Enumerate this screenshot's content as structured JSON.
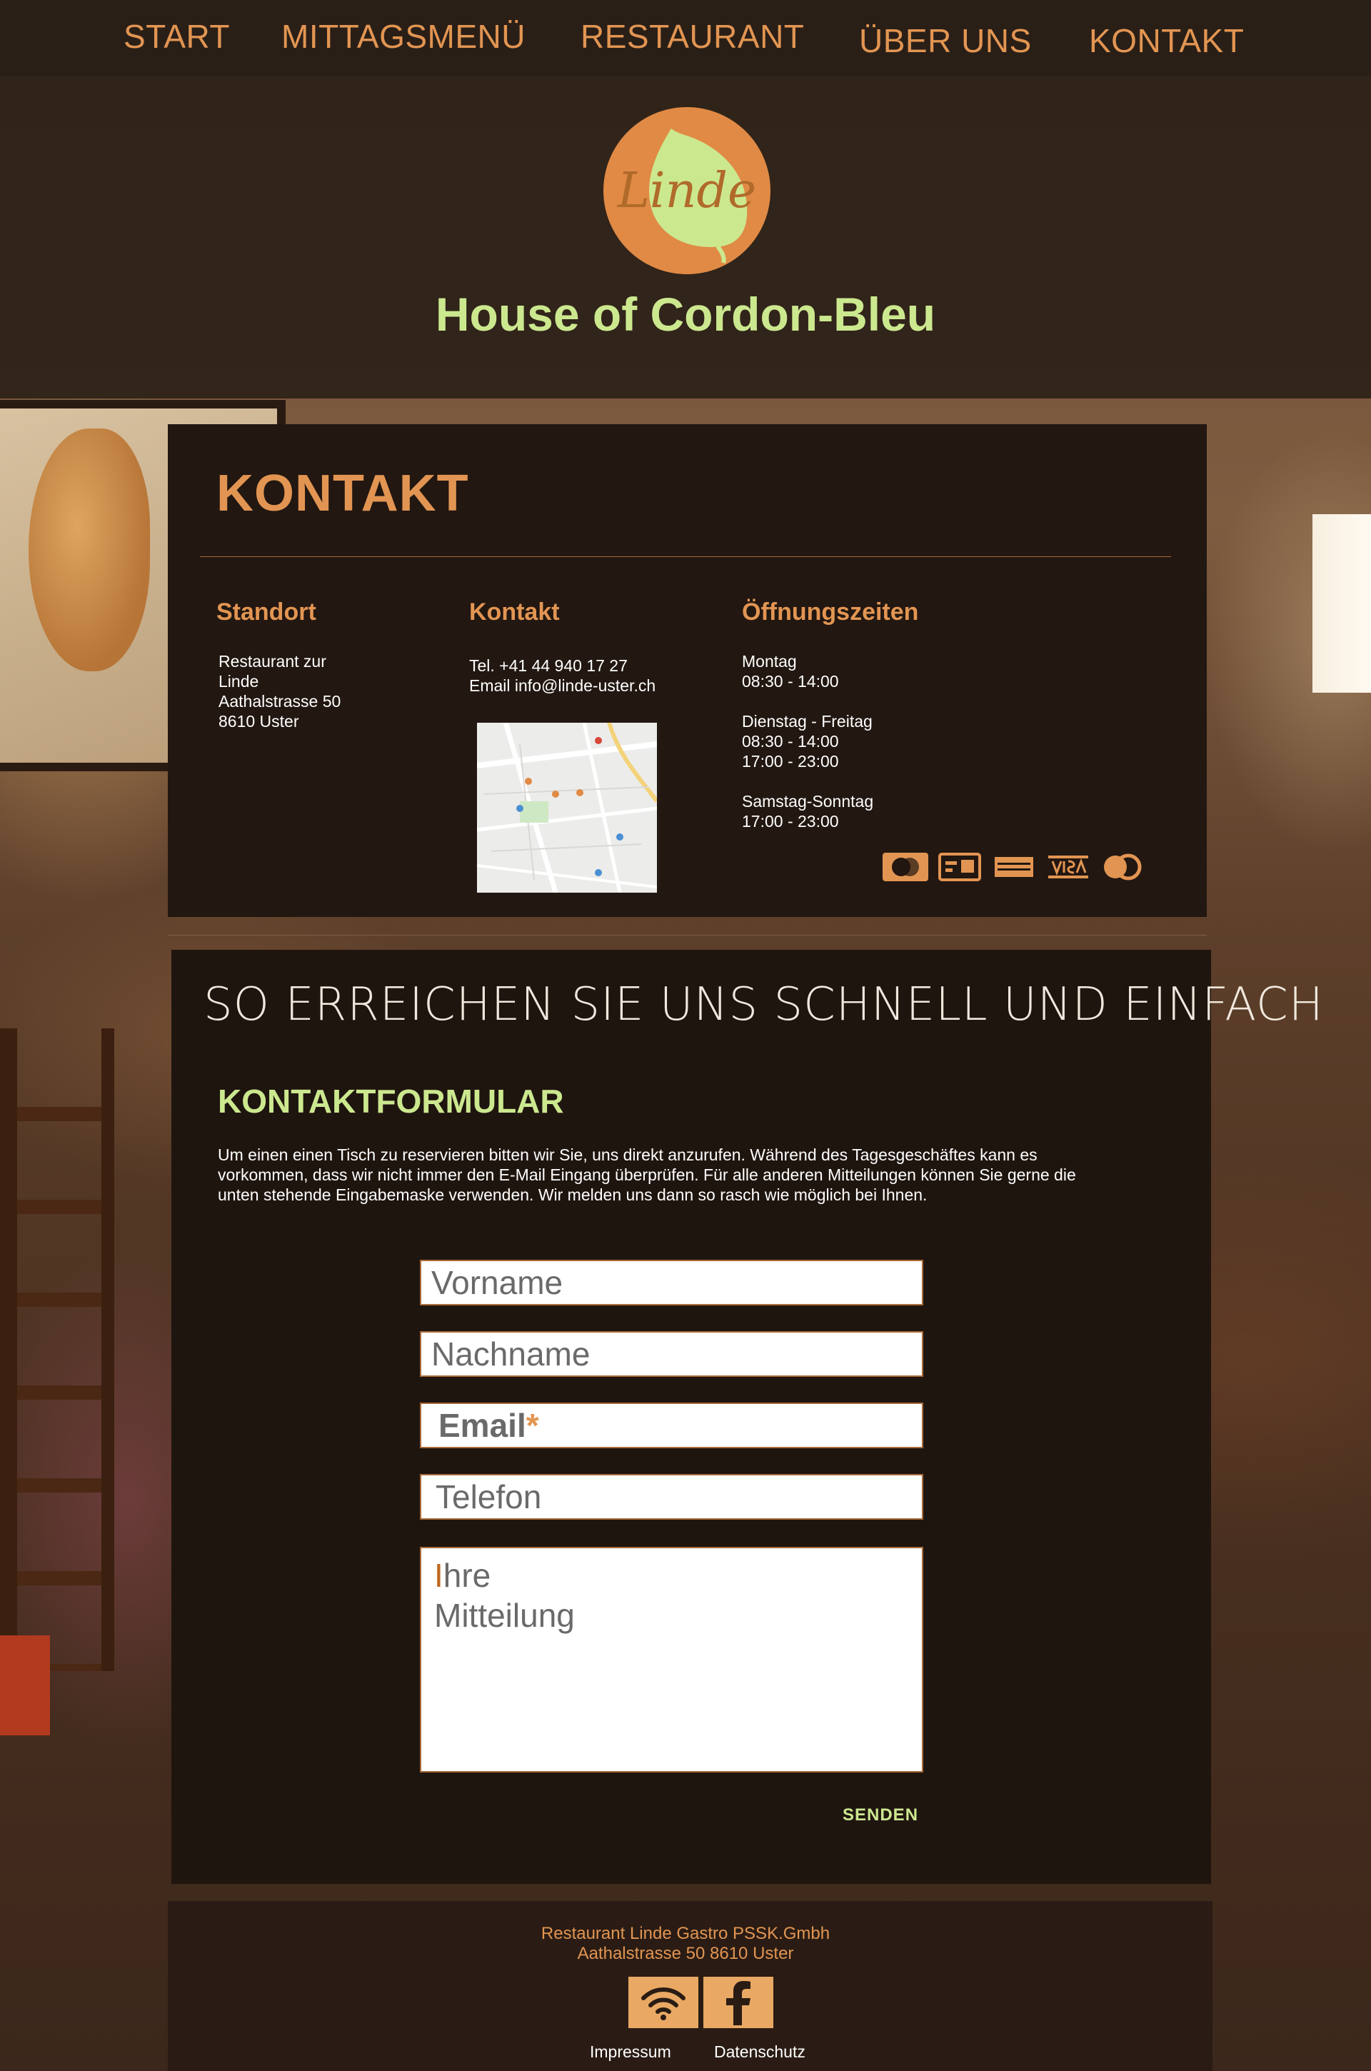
{
  "nav": {
    "items": [
      {
        "label": "START"
      },
      {
        "label": "MITTAGSMENÜ"
      },
      {
        "label": "RESTAURANT"
      },
      {
        "label": "ÜBER UNS"
      },
      {
        "label": "KONTAKT"
      }
    ]
  },
  "header": {
    "logo_text": "Linde",
    "tagline": "House of Cordon-Bleu"
  },
  "kontakt": {
    "title": "KONTAKT",
    "standort": {
      "heading": "Standort",
      "lines": "Restaurant zur\nLinde\nAathalstrasse 50\n8610 Uster"
    },
    "kontakt_col": {
      "heading": "Kontakt",
      "tel": "Tel. +41 44 940 17 27",
      "email": "Email  info@linde-uster.ch"
    },
    "hours": {
      "heading": "Öffnungszeiten",
      "block1": "Montag\n08:30 - 14:00",
      "block2": "Dienstag - Freitag\n08:30 - 14:00\n17:00 - 23:00",
      "block3": "Samstag-Sonntag\n17:00 - 23:00"
    },
    "payments": [
      "mastercard-icon",
      "ec-card-icon",
      "american-express-icon",
      "visa-icon",
      "diners-club-icon"
    ]
  },
  "form": {
    "heading": "SO ERREICHEN SIE UNS SCHNELL UND EINFACH",
    "subheading": "KONTAKTFORMULAR",
    "intro": "Um einen einen Tisch zu reservieren bitten wir Sie, uns direkt anzurufen. Während des Tagesgeschäftes kann es vorkommen, dass wir nicht immer den E-Mail Eingang überprüfen. Für alle anderen Mitteilungen können Sie gerne die unten stehende Eingabemaske verwenden. Wir melden uns dann so rasch wie möglich bei Ihnen.",
    "vorname": "Vorname",
    "nachname": "Nachname",
    "email": "Email",
    "email_required": "*",
    "telefon": "Telefon",
    "message_cursor": "I",
    "message": "hre\nMitteilung",
    "send_label": "SENDEN"
  },
  "footer": {
    "company": "Restaurant Linde Gastro PSSK.Gmbh",
    "address": "Aathalstrasse 50 8610 Uster",
    "impressum": "Impressum",
    "datenschutz": "Datenschutz"
  },
  "colors": {
    "accent": "#e29552",
    "green": "#cce88f",
    "panel": "#221711"
  }
}
